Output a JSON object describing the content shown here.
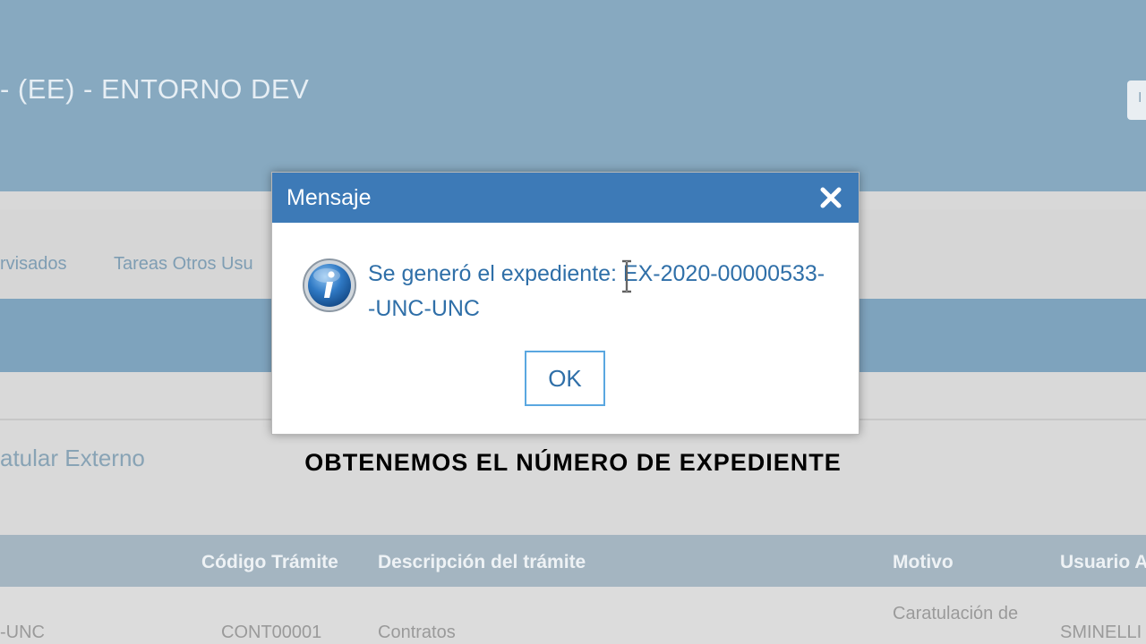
{
  "app": {
    "title": "- (EE) - ENTORNO DEV",
    "header_button_label": "I"
  },
  "tabs": [
    {
      "label": "rvisados"
    },
    {
      "label": "Tareas Otros Usu"
    }
  ],
  "section": {
    "title": "atular Externo"
  },
  "table": {
    "columns": [
      "Código Trámite",
      "Descripción del trámite",
      "Motivo",
      "Usuario A"
    ],
    "rows": [
      {
        "expediente": "-UNC",
        "codigo": "CONT00001",
        "descripcion": "Contratos",
        "motivo": "Caratulación de",
        "usuario": "SMINELLI"
      }
    ]
  },
  "dialog": {
    "title": "Mensaje",
    "message_line1": "Se generó el expediente: EX-2020-00000533-",
    "message_line2": "-UNC-UNC",
    "ok_label": "OK",
    "icon": "info-icon",
    "close_icon": "close-icon"
  },
  "caption": "OBTENEMOS EL NÚMERO DE EXPEDIENTE",
  "colors": {
    "titlebar": "#3d7ab7",
    "header": "#87a9c0",
    "message_text": "#2f6fa8",
    "ok_border": "#5aa7e0"
  }
}
